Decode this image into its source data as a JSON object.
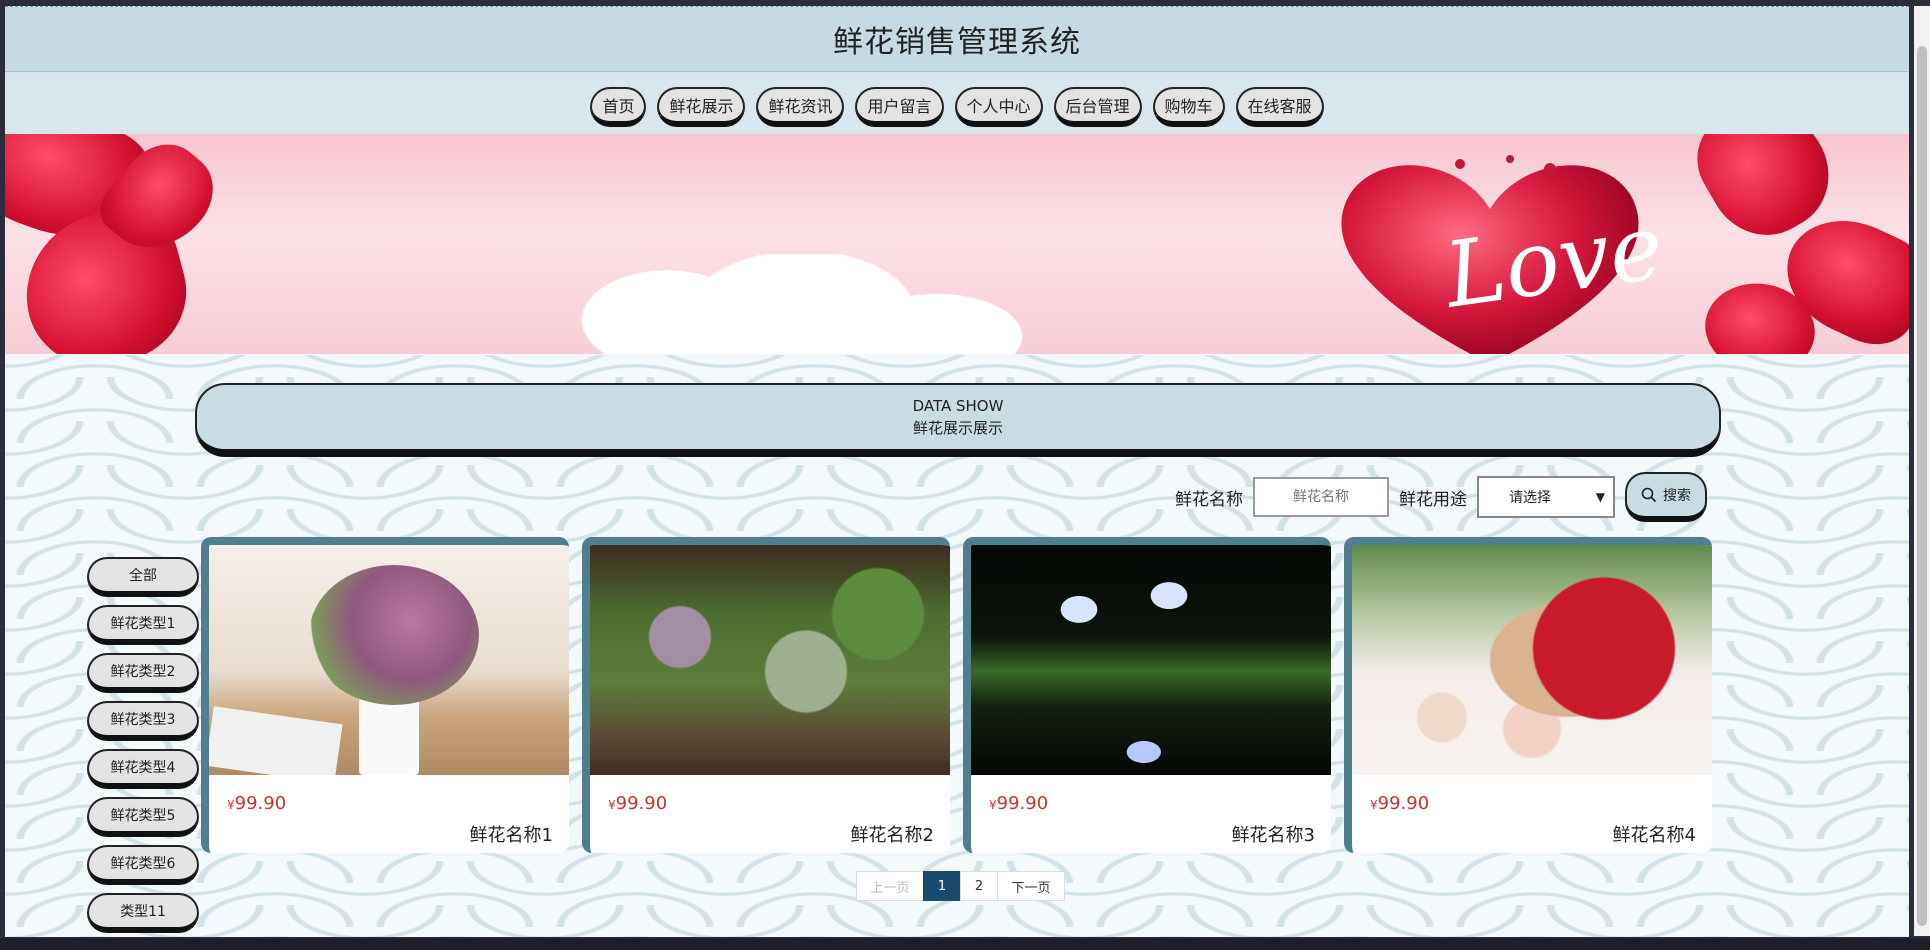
{
  "header": {
    "title": "鲜花销售管理系统"
  },
  "nav": {
    "items": [
      {
        "label": "首页"
      },
      {
        "label": "鲜花展示"
      },
      {
        "label": "鲜花资讯"
      },
      {
        "label": "用户留言"
      },
      {
        "label": "个人中心"
      },
      {
        "label": "后台管理"
      },
      {
        "label": "购物车"
      },
      {
        "label": "在线客服"
      }
    ]
  },
  "banner": {
    "text": "Love"
  },
  "section": {
    "title_en": "DATA SHOW",
    "title_cn": "鲜花展示展示"
  },
  "search": {
    "name_label": "鲜花名称",
    "name_placeholder": "鲜花名称",
    "use_label": "鲜花用途",
    "use_selected": "请选择",
    "button_label": "搜索"
  },
  "categories": [
    {
      "label": "全部"
    },
    {
      "label": "鲜花类型1"
    },
    {
      "label": "鲜花类型2"
    },
    {
      "label": "鲜花类型3"
    },
    {
      "label": "鲜花类型4"
    },
    {
      "label": "鲜花类型5"
    },
    {
      "label": "鲜花类型6"
    },
    {
      "label": "类型11"
    }
  ],
  "products": [
    {
      "currency": "¥",
      "price": "99.90",
      "name": "鲜花名称1"
    },
    {
      "currency": "¥",
      "price": "99.90",
      "name": "鲜花名称2"
    },
    {
      "currency": "¥",
      "price": "99.90",
      "name": "鲜花名称3"
    },
    {
      "currency": "¥",
      "price": "99.90",
      "name": "鲜花名称4"
    }
  ],
  "pagination": {
    "prev": "上一页",
    "pages": [
      "1",
      "2"
    ],
    "current": "1",
    "next": "下一页"
  },
  "colors": {
    "header_bg": "#c5dae2",
    "card_border": "#4f7f8e",
    "price": "#c8342c",
    "active_page": "#1c4a6e"
  }
}
